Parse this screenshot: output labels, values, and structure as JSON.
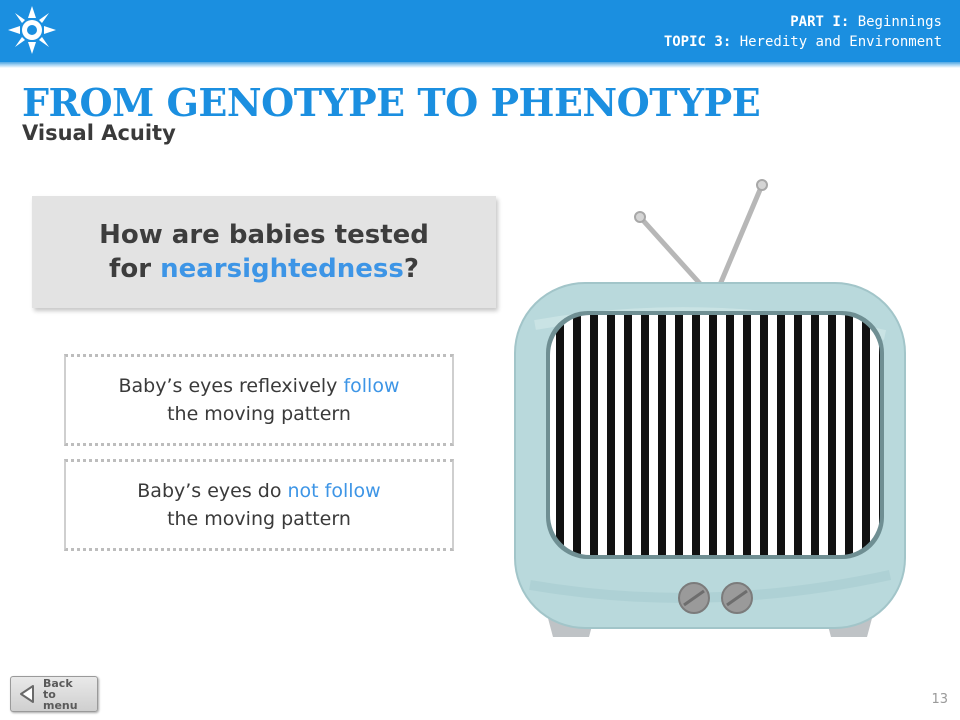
{
  "header": {
    "part_label": "PART I:",
    "part_title": "Beginnings",
    "topic_label": "TOPIC 3:",
    "topic_title": "Heredity and Environment"
  },
  "title": "FROM GENOTYPE TO PHENOTYPE",
  "subtitle": "Visual Acuity",
  "question": {
    "line1": "How are babies tested",
    "line2_prefix": "for ",
    "line2_highlight": "nearsightedness",
    "line2_suffix": "?"
  },
  "answers": [
    {
      "prefix": "Baby’s eyes reflexively ",
      "highlight": "follow",
      "line2": "the moving pattern"
    },
    {
      "prefix": "Baby’s eyes do ",
      "highlight": "not follow",
      "line2": "the moving pattern"
    }
  ],
  "back_button": {
    "label": "Back\nto menu"
  },
  "page_number": "13",
  "colors": {
    "banner": "#1b8fe0",
    "title": "#1b8fe0",
    "highlight": "#3d95e6",
    "tv_body": "#b9d9dc"
  },
  "icons": {
    "logo": "sun-icon",
    "back": "triangle-left-icon"
  }
}
